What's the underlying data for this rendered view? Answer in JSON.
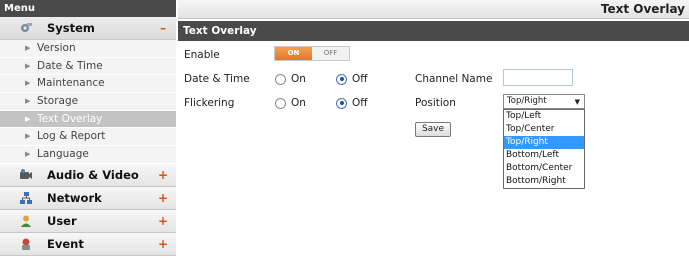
{
  "sidebar": {
    "title": "Menu",
    "categories": [
      {
        "label": "System",
        "sign": "–"
      },
      {
        "label": "Audio & Video",
        "sign": "+"
      },
      {
        "label": "Network",
        "sign": "+"
      },
      {
        "label": "User",
        "sign": "+"
      },
      {
        "label": "Event",
        "sign": "+"
      }
    ],
    "system_items": [
      {
        "label": "Version"
      },
      {
        "label": "Date & Time"
      },
      {
        "label": "Maintenance"
      },
      {
        "label": "Storage"
      },
      {
        "label": "Text Overlay"
      },
      {
        "label": "Log & Report"
      },
      {
        "label": "Language"
      }
    ]
  },
  "page": {
    "title": "Text Overlay"
  },
  "section": {
    "title": "Text Overlay"
  },
  "form": {
    "enable": {
      "label": "Enable",
      "on": "ON",
      "off": "OFF",
      "value": "ON"
    },
    "date_time": {
      "label": "Date & Time",
      "on": "On",
      "off": "Off",
      "value": "Off"
    },
    "channel_name": {
      "label": "Channel Name",
      "value": ""
    },
    "flickering": {
      "label": "Flickering",
      "on": "On",
      "off": "Off",
      "value": "Off"
    },
    "position": {
      "label": "Position",
      "selected": "Top/Right",
      "options": [
        "Top/Left",
        "Top/Center",
        "Top/Right",
        "Bottom/Left",
        "Bottom/Center",
        "Bottom/Right"
      ]
    },
    "save_label": "Save"
  },
  "colors": {
    "accent": "#e3762a",
    "header": "#4a4a4a",
    "selection": "#3399ff"
  }
}
